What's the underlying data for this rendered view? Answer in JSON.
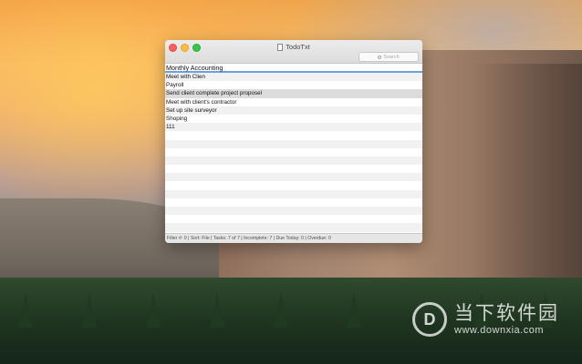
{
  "window": {
    "title": "TodoTxt",
    "search_placeholder": "Search"
  },
  "tasks": [
    "Monthly Accounting",
    "Meet with Clien",
    "Payroll",
    "Send client complete project proposel",
    "Meet with client's contractor",
    "Set up site surveyor",
    "Shoping",
    "111"
  ],
  "status_bar": "Filter #: 0 | Sort: File | Tasks: 7 of 7 | Incomplete: 7 | Due Today: 0 | Overdue: 0",
  "watermark": {
    "logo": "D",
    "name": "当下软件园",
    "url": "www.downxia.com"
  }
}
